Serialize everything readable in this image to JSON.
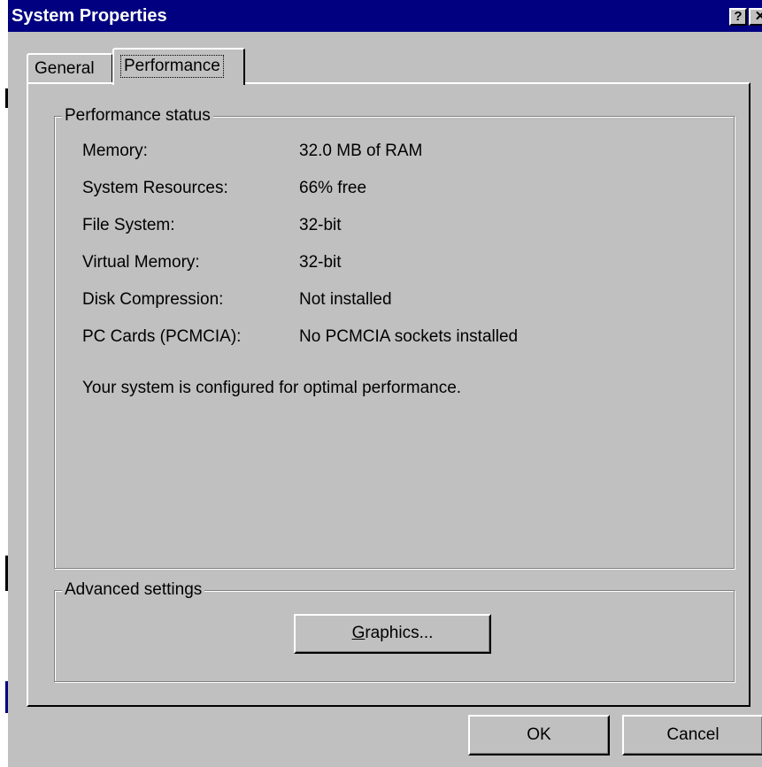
{
  "window": {
    "title": "System Properties",
    "help_label": "?",
    "close_label": "✕"
  },
  "tabs": [
    {
      "label": "General",
      "selected": false
    },
    {
      "label": "Performance",
      "selected": true
    }
  ],
  "performance_status": {
    "group_label": "Performance status",
    "rows": [
      {
        "label": "Memory:",
        "value": "32.0 MB of RAM"
      },
      {
        "label": "System Resources:",
        "value": "66% free"
      },
      {
        "label": "File System:",
        "value": "32-bit"
      },
      {
        "label": "Virtual Memory:",
        "value": "32-bit"
      },
      {
        "label": "Disk Compression:",
        "value": "Not installed"
      },
      {
        "label": "PC Cards (PCMCIA):",
        "value": "No PCMCIA sockets installed"
      }
    ],
    "message": "Your system is configured for optimal performance."
  },
  "advanced_settings": {
    "group_label": "Advanced settings",
    "graphics_button": {
      "mnemonic": "G",
      "rest": "raphics..."
    }
  },
  "footer": {
    "ok_label": "OK",
    "cancel_label": "Cancel"
  },
  "colors": {
    "title_bar": "#000080",
    "face": "#c0c0c0"
  }
}
